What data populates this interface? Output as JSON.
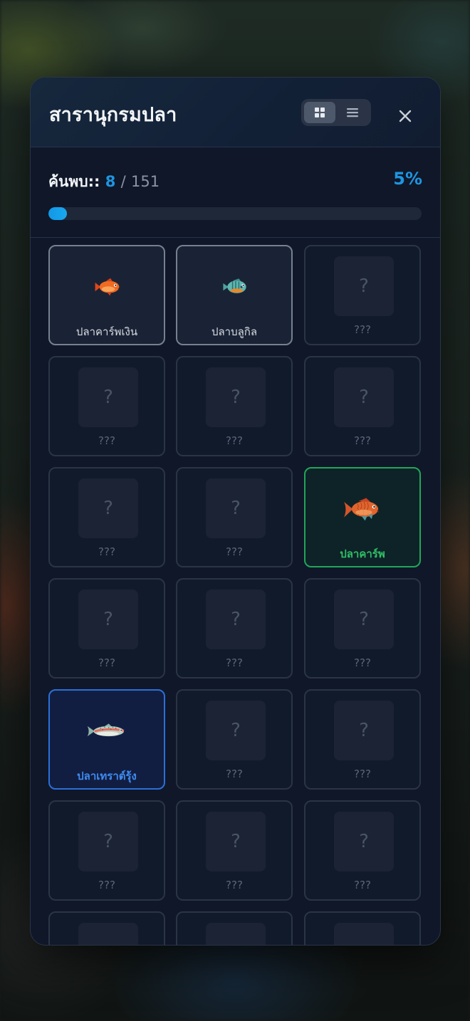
{
  "modal": {
    "title": "สารานุกรมปลา",
    "view_toggle": {
      "grid_icon": "grid-icon",
      "list_icon": "list-icon",
      "active": "grid"
    },
    "close_icon": "close-icon"
  },
  "progress": {
    "label": "ค้นพบ::",
    "discovered": "8",
    "separator": "/",
    "total": "151",
    "percent_text": "5%",
    "fraction": 0.05
  },
  "colors": {
    "accent": "#1e95e0",
    "found_green": "#22a55a",
    "found_blue": "#2d6fd6",
    "found_gray": "#76808f"
  },
  "cards": [
    {
      "label": "ปลาคาร์พเงิน",
      "state": "found-gray",
      "icon": "small-orange-fish-icon"
    },
    {
      "label": "ปลาบลูกิล",
      "state": "found-gray",
      "icon": "bluegill-fish-icon"
    },
    {
      "label": "???",
      "state": "locked",
      "icon": "question-icon",
      "q": "?"
    },
    {
      "label": "???",
      "state": "locked",
      "icon": "question-icon",
      "q": "?"
    },
    {
      "label": "???",
      "state": "locked",
      "icon": "question-icon",
      "q": "?"
    },
    {
      "label": "???",
      "state": "locked",
      "icon": "question-icon",
      "q": "?"
    },
    {
      "label": "???",
      "state": "locked",
      "icon": "question-icon",
      "q": "?"
    },
    {
      "label": "???",
      "state": "locked",
      "icon": "question-icon",
      "q": "?"
    },
    {
      "label": "ปลาคาร์พ",
      "state": "found-green",
      "icon": "carp-fish-icon"
    },
    {
      "label": "???",
      "state": "locked",
      "icon": "question-icon",
      "q": "?"
    },
    {
      "label": "???",
      "state": "locked",
      "icon": "question-icon",
      "q": "?"
    },
    {
      "label": "???",
      "state": "locked",
      "icon": "question-icon",
      "q": "?"
    },
    {
      "label": "ปลาเทราต์รุ้ง",
      "state": "found-blue",
      "icon": "rainbow-trout-fish-icon"
    },
    {
      "label": "???",
      "state": "locked",
      "icon": "question-icon",
      "q": "?"
    },
    {
      "label": "???",
      "state": "locked",
      "icon": "question-icon",
      "q": "?"
    },
    {
      "label": "???",
      "state": "locked",
      "icon": "question-icon",
      "q": "?"
    },
    {
      "label": "???",
      "state": "locked",
      "icon": "question-icon",
      "q": "?"
    },
    {
      "label": "???",
      "state": "locked",
      "icon": "question-icon",
      "q": "?"
    },
    {
      "label": "",
      "state": "locked",
      "icon": "question-icon",
      "q": ""
    },
    {
      "label": "",
      "state": "locked",
      "icon": "question-icon",
      "q": ""
    },
    {
      "label": "",
      "state": "locked",
      "icon": "question-icon",
      "q": ""
    }
  ]
}
